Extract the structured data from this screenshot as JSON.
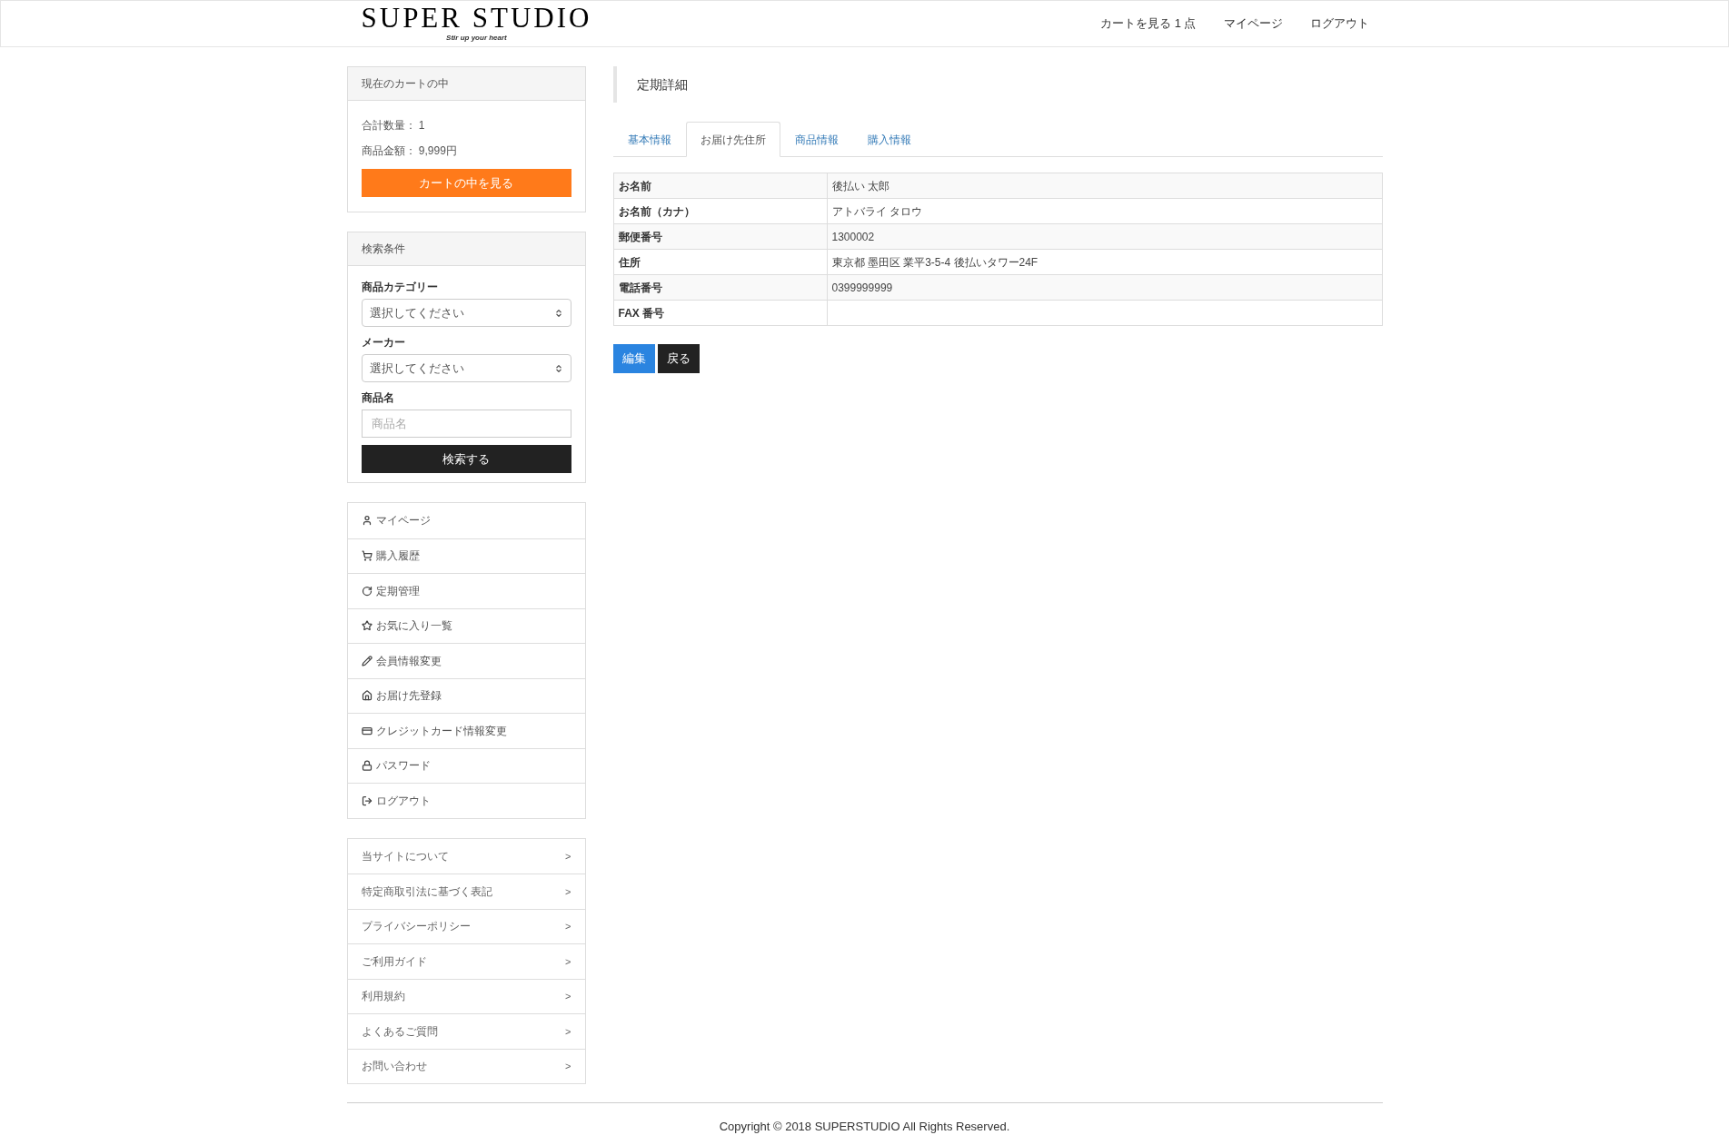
{
  "header": {
    "logo": "SUPER STUDIO",
    "tagline": "Stir up your heart",
    "nav": [
      "カートを見る 1 点",
      "マイページ",
      "ログアウト"
    ]
  },
  "cart": {
    "title": "現在のカートの中",
    "lines": [
      "合計数量： 1",
      "商品金額： 9,999円"
    ],
    "button": "カートの中を見る"
  },
  "search": {
    "title": "検索条件",
    "fields": [
      {
        "kind": "select",
        "label": "商品カテゴリー",
        "value": "選択してください"
      },
      {
        "kind": "select",
        "label": "メーカー",
        "value": "選択してください"
      },
      {
        "kind": "text",
        "label": "商品名",
        "placeholder": "商品名"
      }
    ],
    "button": "検索する"
  },
  "menu": [
    {
      "kind": "user",
      "label": "マイページ"
    },
    {
      "kind": "cart",
      "label": "購入履歴"
    },
    {
      "kind": "refresh",
      "label": "定期管理"
    },
    {
      "kind": "star",
      "label": "お気に入り一覧"
    },
    {
      "kind": "pencil",
      "label": "会員情報変更"
    },
    {
      "kind": "home",
      "label": "お届け先登録"
    },
    {
      "kind": "card",
      "label": "クレジットカード情報変更"
    },
    {
      "kind": "lock",
      "label": "パスワード"
    },
    {
      "kind": "logout",
      "label": "ログアウト"
    }
  ],
  "links": [
    {
      "label": "当サイトについて",
      "arrow": ">"
    },
    {
      "label": "特定商取引法に基づく表記",
      "arrow": ">"
    },
    {
      "label": "プライバシーポリシー",
      "arrow": ">"
    },
    {
      "label": "ご利用ガイド",
      "arrow": ">"
    },
    {
      "label": "利用規約",
      "arrow": ">"
    },
    {
      "label": "よくあるご質問",
      "arrow": ">"
    },
    {
      "label": "お問い合わせ",
      "arrow": ">"
    }
  ],
  "page_title": "定期詳細",
  "tabs": [
    {
      "label": "基本情報",
      "selected": false
    },
    {
      "label": "お届け先住所",
      "selected": true
    },
    {
      "label": "商品情報",
      "selected": false
    },
    {
      "label": "購入情報",
      "selected": false
    }
  ],
  "table": {
    "rows": [
      {
        "label": "お名前",
        "value": "後払い 太郎"
      },
      {
        "label": "お名前（カナ）",
        "value": "アトバライ タロウ"
      },
      {
        "label": "郵便番号",
        "value": "1300002"
      },
      {
        "label": "住所",
        "value": "東京都 墨田区 業平3-5-4 後払いタワー24F"
      },
      {
        "label": "電話番号",
        "value": "0399999999"
      },
      {
        "label": "FAX 番号"
      }
    ]
  },
  "buttons": [
    {
      "kind": "primary",
      "label": "編集"
    },
    {
      "kind": "dark",
      "label": "戻る"
    }
  ],
  "footer": "Copyright © 2018 SUPERSTUDIO All Rights Reserved."
}
